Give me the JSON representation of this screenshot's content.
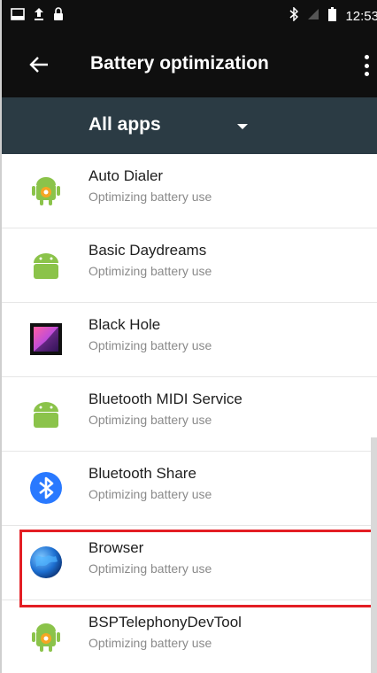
{
  "status_bar": {
    "time": "12:53",
    "left_icons": [
      "screenshot-icon",
      "upload-icon",
      "lock-icon"
    ],
    "right_icons": [
      "bluetooth-icon",
      "no-signal-icon",
      "battery-icon"
    ]
  },
  "app_bar": {
    "title": "Battery optimization",
    "back_icon": "arrow-left-icon",
    "menu_icon": "more-vert-icon"
  },
  "filter": {
    "selected": "All apps"
  },
  "apps": [
    {
      "name": "Auto Dialer",
      "status": "Optimizing battery use",
      "icon": "android-gear-icon"
    },
    {
      "name": "Basic Daydreams",
      "status": "Optimizing battery use",
      "icon": "android-icon"
    },
    {
      "name": "Black Hole",
      "status": "Optimizing battery use",
      "icon": "black-hole-icon"
    },
    {
      "name": "Bluetooth MIDI Service",
      "status": "Optimizing battery use",
      "icon": "android-icon"
    },
    {
      "name": "Bluetooth Share",
      "status": "Optimizing battery use",
      "icon": "bluetooth-icon"
    },
    {
      "name": "Browser",
      "status": "Optimizing battery use",
      "icon": "globe-icon"
    },
    {
      "name": "BSPTelephonyDevTool",
      "status": "Optimizing battery use",
      "icon": "android-gear-icon"
    }
  ],
  "highlighted_app": "Browser",
  "colors": {
    "status_bar": "#0f0f0f",
    "app_bar": "#0f0f0f",
    "filter_bar": "#2b3b44",
    "android_green": "#8bc34a",
    "bluetooth_blue": "#2979ff",
    "highlight_red": "#e31e24"
  }
}
